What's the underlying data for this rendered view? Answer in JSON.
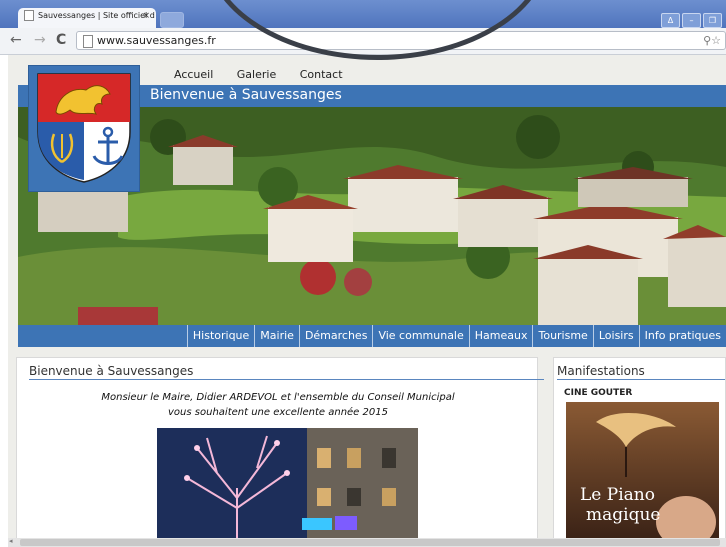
{
  "browser": {
    "tab_title": "Sauvessanges | Site officiel d",
    "tab_close": "×",
    "url": "www.sauvessanges.fr",
    "back": "←",
    "forward": "→",
    "reload": "C",
    "window_buttons": [
      "Δ",
      "–",
      "❐"
    ],
    "toolbar_icons": "⚲☆"
  },
  "site": {
    "top_nav": [
      "Accueil",
      "Galerie",
      "Contact"
    ],
    "banner_title": "Bienvenue à Sauvessanges",
    "main_nav": [
      "Historique",
      "Mairie",
      "Démarches",
      "Vie communale",
      "Hameaux",
      "Tourisme",
      "Loisirs",
      "Info pratiques"
    ],
    "colors": {
      "nav_blue": "#3d74b5",
      "rule_blue": "#5a86bf"
    }
  },
  "content": {
    "heading": "Bienvenue à Sauvessanges",
    "message_line1": "Monsieur le Maire, Didier ARDEVOL et l'ensemble du Conseil Municipal",
    "message_line2": "vous souhaitent une excellente année 2015"
  },
  "sidebar": {
    "heading": "Manifestations",
    "event_title": "CINE GOUTER",
    "poster_word1": "Le Piano",
    "poster_word2": "magique"
  }
}
